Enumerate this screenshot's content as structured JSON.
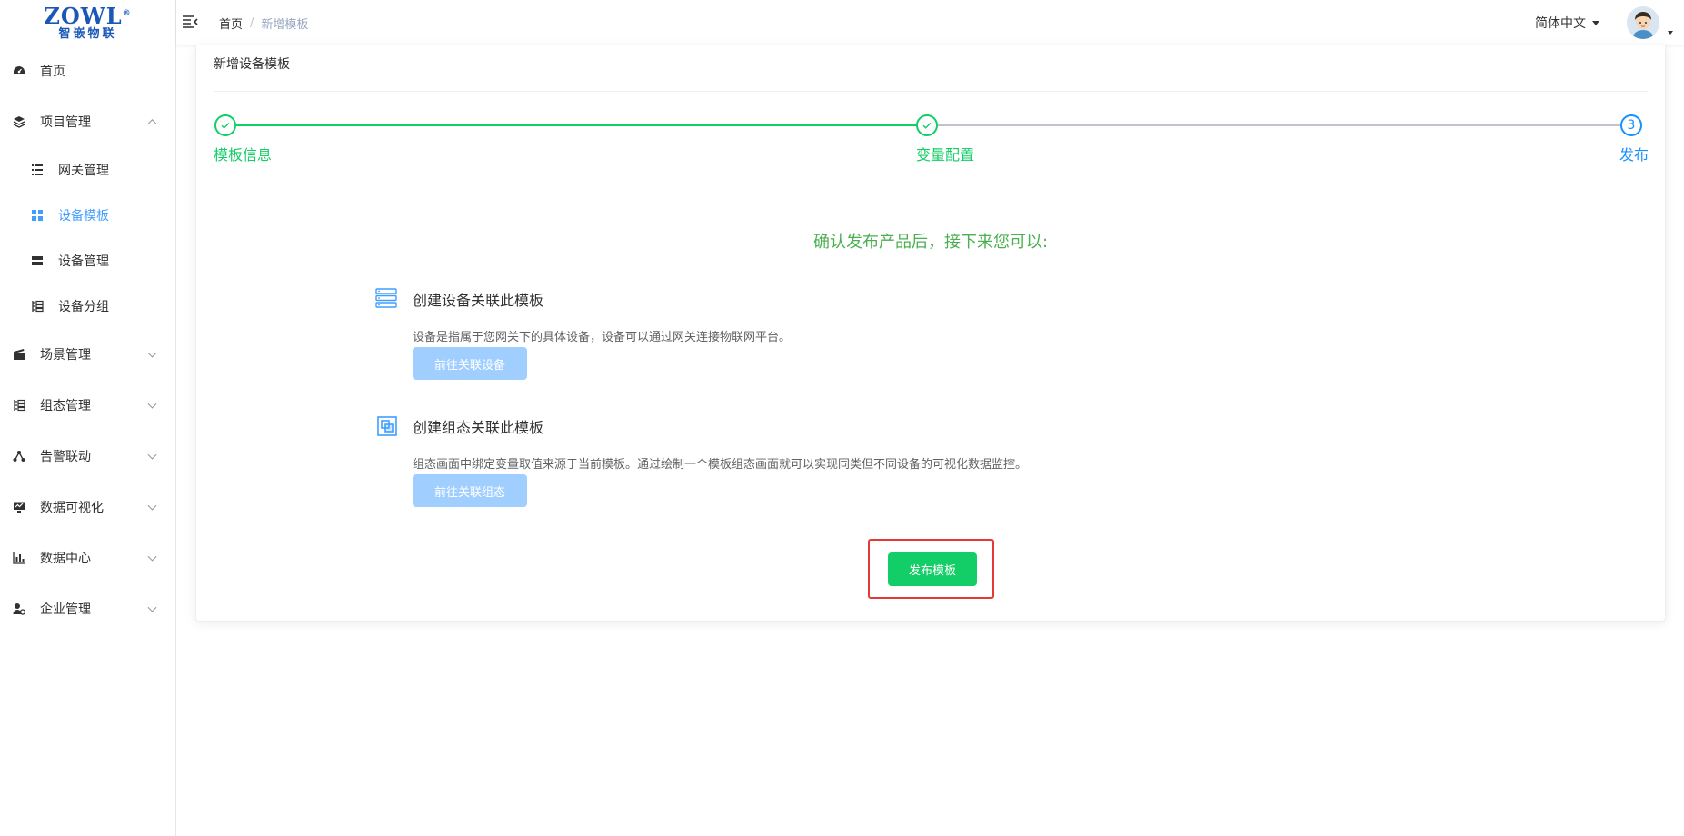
{
  "logo": {
    "line1": "ZOWL",
    "line2": "智嵌物联",
    "registered": "®"
  },
  "header": {
    "breadcrumb": [
      "首页",
      "新增模板"
    ],
    "separator": "/",
    "language": "简体中文"
  },
  "sidebar": {
    "items": [
      {
        "label": "首页",
        "icon": "dashboard-icon"
      },
      {
        "label": "项目管理",
        "icon": "layers-icon",
        "expanded": true
      },
      {
        "label": "场景管理",
        "icon": "clapper-icon"
      },
      {
        "label": "组态管理",
        "icon": "tree-icon"
      },
      {
        "label": "告警联动",
        "icon": "link-nodes-icon"
      },
      {
        "label": "数据可视化",
        "icon": "monitor-icon"
      },
      {
        "label": "数据中心",
        "icon": "bar-chart-icon"
      },
      {
        "label": "企业管理",
        "icon": "user-settings-icon"
      }
    ],
    "sub_items": [
      {
        "label": "网关管理",
        "icon": "list-icon"
      },
      {
        "label": "设备模板",
        "icon": "grid-icon",
        "active": true
      },
      {
        "label": "设备管理",
        "icon": "server-icon"
      },
      {
        "label": "设备分组",
        "icon": "group-icon"
      }
    ]
  },
  "card": {
    "title": "新增设备模板",
    "steps": [
      {
        "label": "模板信息",
        "status": "finished"
      },
      {
        "label": "变量配置",
        "status": "finished"
      },
      {
        "label": "发布",
        "number": "3",
        "status": "current"
      }
    ],
    "confirm_title": "确认发布产品后，接下来您可以:",
    "sections": [
      {
        "title": "创建设备关联此模板",
        "description": "设备是指属于您网关下的具体设备，设备可以通过网关连接物联网平台。",
        "button": "前往关联设备"
      },
      {
        "title": "创建组态关联此模板",
        "description": "组态画面中绑定变量取值来源于当前模板。通过绘制一个模板组态画面就可以实现同类但不同设备的可视化数据监控。",
        "button": "前往关联组态"
      }
    ],
    "publish_button": "发布模板"
  },
  "colors": {
    "success": "#13ce66",
    "primary": "#1890ff",
    "active_menu": "#409eff",
    "disabled_button": "#a0cfff",
    "highlight_box": "#e53935"
  }
}
